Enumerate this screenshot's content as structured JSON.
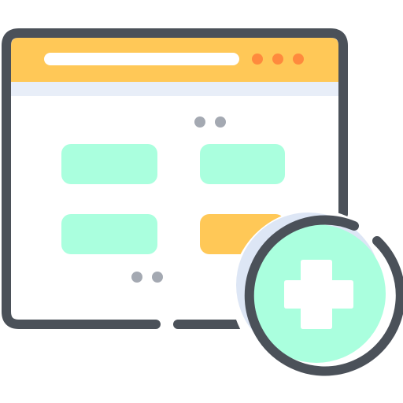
{
  "icon": {
    "name": "add-web-page-icon",
    "browser_window": {
      "address_bar": "address-bar-icon",
      "dots": [
        "dot-icon",
        "dot-icon",
        "dot-icon"
      ]
    },
    "add_badge": "plus-icon"
  },
  "colors": {
    "outline": "#4B5159",
    "header": "#FFC857",
    "header_bottom": "#FFB347",
    "window_body": "#FFFFFF",
    "window_tint": "#E8EEF8",
    "address_bar": "#FFFFFF",
    "window_dots": "#FF8A3D",
    "tile_mint": "#AAFFDE",
    "tile_highlight": "#FFC857",
    "pager_dots": "#A4A9B2",
    "badge_fill": "#AAFFDE",
    "badge_shadow": "#DDE6F5",
    "plus": "#FFFFFF"
  }
}
